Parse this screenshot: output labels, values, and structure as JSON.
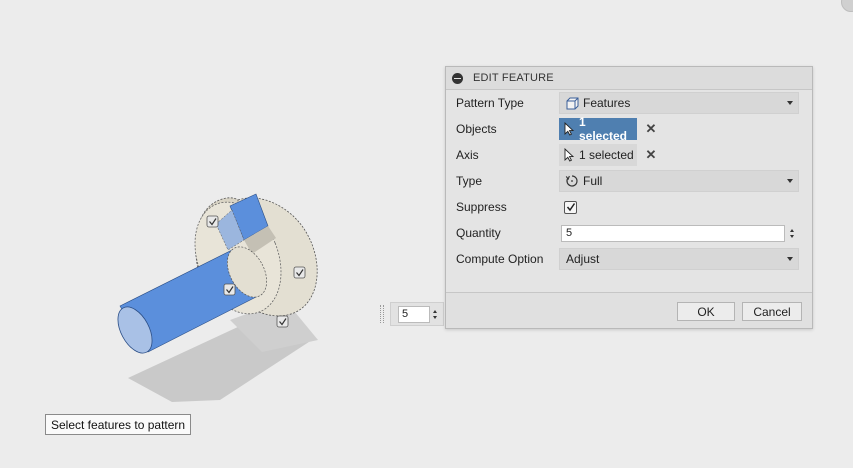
{
  "panel": {
    "title": "EDIT FEATURE",
    "rows": {
      "pattern_type": {
        "label": "Pattern Type",
        "value": "Features",
        "icon": "features-icon"
      },
      "objects": {
        "label": "Objects",
        "value": "1 selected",
        "icon": "cursor-icon",
        "state": "active"
      },
      "axis": {
        "label": "Axis",
        "value": "1 selected",
        "icon": "cursor-icon",
        "state": "inactive"
      },
      "type": {
        "label": "Type",
        "value": "Full",
        "icon": "rotate-icon"
      },
      "suppress": {
        "label": "Suppress",
        "checked": true
      },
      "quantity": {
        "label": "Quantity",
        "value": "5"
      },
      "compute_option": {
        "label": "Compute Option",
        "value": "Adjust"
      }
    },
    "ok_label": "OK",
    "cancel_label": "Cancel"
  },
  "mini_toolbar": {
    "quantity": "5",
    "type_icon": "rotate-icon"
  },
  "tooltip": {
    "text": "Select features to pattern"
  },
  "colors": {
    "selection_blue": "#4f7fb0",
    "model_blue": "#5b8fdc",
    "model_beige": "#e3dfd2",
    "panel_bg": "#e4e4e4"
  }
}
